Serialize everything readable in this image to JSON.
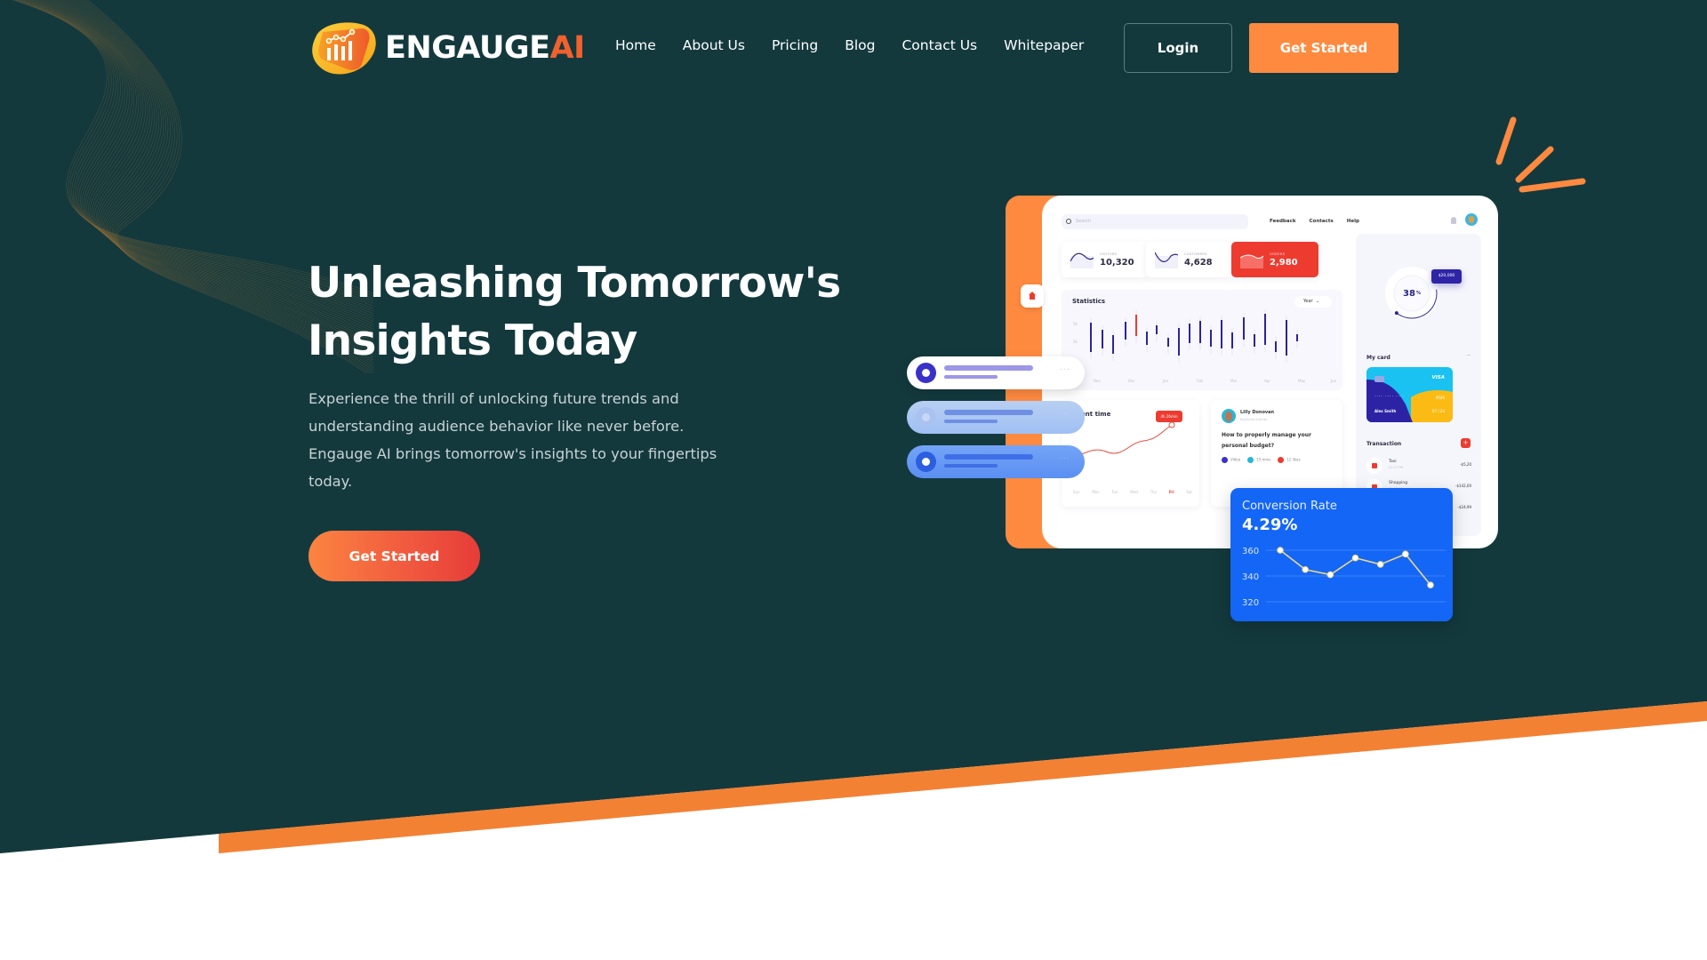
{
  "brand": {
    "name_main": "ENGAUGE",
    "name_accent": "AI"
  },
  "nav": {
    "items": [
      {
        "label": "Home"
      },
      {
        "label": "About Us"
      },
      {
        "label": "Pricing"
      },
      {
        "label": "Blog"
      },
      {
        "label": "Contact Us"
      },
      {
        "label": "Whitepaper"
      }
    ],
    "login_label": "Login",
    "get_started_label": "Get Started"
  },
  "hero": {
    "headline_line1": "Unleashing Tomorrow's",
    "headline_line2": "Insights Today",
    "paragraph": "Experience the thrill of unlocking future trends and understanding audience behavior like never before. Engauge AI brings tomorrow's insights to your fingertips today.",
    "cta_label": "Get Started"
  },
  "colors": {
    "background": "#13393d",
    "accent_orange": "#fe8a40",
    "accent_red": "#e63c38",
    "conversion_blue": "#1466f6"
  },
  "dashboard": {
    "search_placeholder": "Search",
    "top_links": [
      "Feedback",
      "Contacts",
      "Help"
    ],
    "stats": [
      {
        "label": "VISITORS",
        "value": "10,320"
      },
      {
        "label": "CUSTOMERS",
        "value": "4,628"
      },
      {
        "label": "ORDERS",
        "value": "2,980"
      }
    ],
    "statistics": {
      "title": "Statistics",
      "period": "Year",
      "y_labels": [
        "5k",
        "2k"
      ],
      "months": [
        "Nov",
        "Dec",
        "Jan",
        "Feb",
        "Mar",
        "Apr",
        "May",
        "Jun"
      ]
    },
    "gauge": {
      "value": "38",
      "unit": "%",
      "fraction": 0.38
    },
    "salary_badge": "$20,000",
    "my_card": {
      "title": "My card",
      "more": "··",
      "brand": "VISA",
      "number_masked": "···· ···· ····",
      "last4": "9546",
      "holder": "Alex Smith",
      "expiry": "07 / 24"
    },
    "transactions": {
      "title": "Transaction",
      "add": "+",
      "items": [
        {
          "name": "Taxi",
          "time": "01:23 PM",
          "amount": "-$5,20"
        },
        {
          "name": "Shopping",
          "time": "01:23 PM",
          "amount": "-$142,00"
        },
        {
          "name": "",
          "time": "",
          "amount": "-$24,99"
        }
      ]
    },
    "spent_time": {
      "title": "Spent time",
      "tooltip": "4h 26min",
      "days": [
        "Sun",
        "Mon",
        "Tue",
        "Wed",
        "Thu",
        "Fri",
        "Sat"
      ],
      "active_day": "Fri"
    },
    "post": {
      "author": "Lilly Donovan",
      "role": "Business trainer",
      "question": "How to properly manage your personal budget?",
      "meta": [
        "Video",
        "15 mins",
        "12 likes"
      ]
    }
  },
  "conversion": {
    "title": "Conversion Rate",
    "value": "4.29%"
  },
  "chart_data": {
    "type": "line",
    "title": "Conversion Rate",
    "subtitle": "4.29%",
    "x": [
      1,
      2,
      3,
      4,
      5,
      6,
      7
    ],
    "values": [
      360,
      345,
      341,
      354,
      349,
      357,
      333
    ],
    "y_ticks": [
      360,
      340,
      320
    ],
    "ylim": [
      320,
      365
    ],
    "grid": true
  }
}
